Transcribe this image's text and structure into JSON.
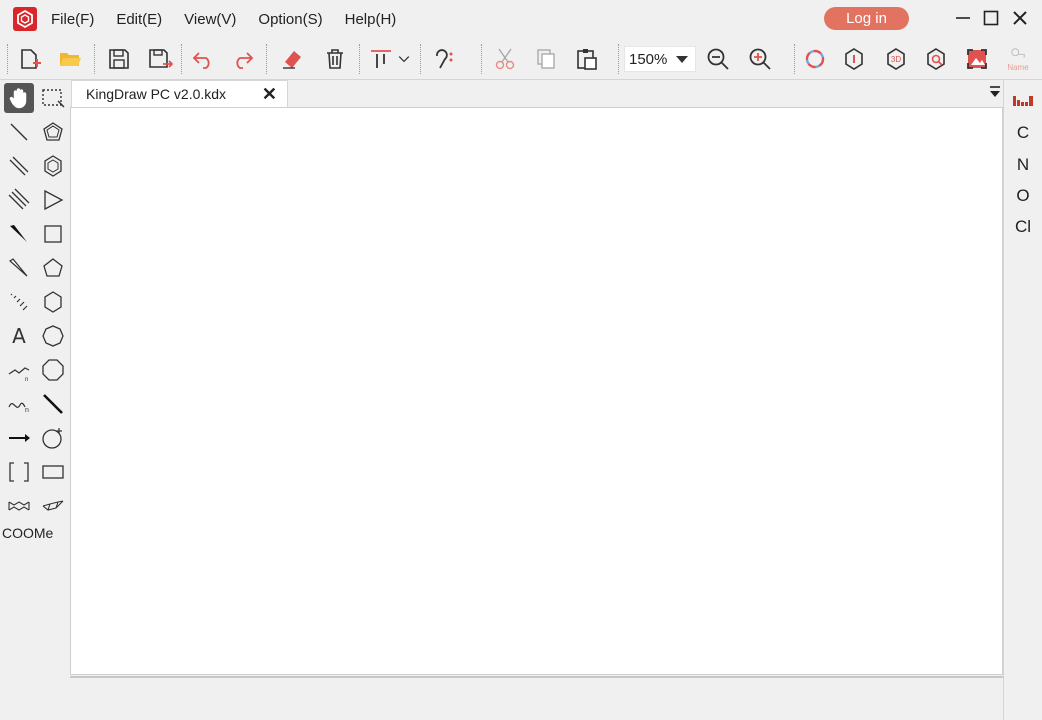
{
  "menu": {
    "items": [
      "File(F)",
      "Edit(E)",
      "View(V)",
      "Option(S)",
      "Help(H)"
    ],
    "login_label": "Log in"
  },
  "toolbar": {
    "zoom_value": "150%",
    "name_tool_label": "Name"
  },
  "tab": {
    "title": "KingDraw PC v2.0.kdx",
    "close_symbol": "✕"
  },
  "palette": {
    "text_tool": "A",
    "group_label": "COOMe"
  },
  "elements": [
    "C",
    "N",
    "O",
    "Cl"
  ],
  "colors": {
    "brand": "#d9262b",
    "login_bg": "#e27361",
    "icon_red": "#e0524f",
    "background": "#f0f0f0"
  }
}
